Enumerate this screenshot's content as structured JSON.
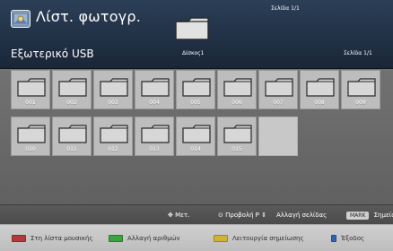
{
  "header": {
    "title": "Λίστ. φωτογρ.",
    "source": "Εξωτερικό USB",
    "disk": "Δίσκος1",
    "page_top": "Σελίδα 1/1",
    "page_right": "Σελίδα 1/1"
  },
  "grid": {
    "folders": [
      "001",
      "002",
      "003",
      "004",
      "005",
      "006",
      "007",
      "008",
      "009",
      "010",
      "011",
      "012",
      "013",
      "014",
      "015"
    ]
  },
  "info_bar": {
    "move_label": "Μετ.",
    "view_label": "Προβολή",
    "page_label": "Αλλαγή σελίδας",
    "mark_key": "MARK",
    "mark_label": "Σημείωσ"
  },
  "bottom": {
    "red_label": "Στη λίστα μουσικής",
    "green_label": "Αλλαγή αριθμών",
    "yellow_label": "Λειτουργία σημείωσης",
    "blue_label": "Έξοδος"
  },
  "colors": {
    "red": "#b33a3a",
    "green": "#3ba33b",
    "yellow": "#d1b234",
    "blue": "#2f63b5"
  }
}
